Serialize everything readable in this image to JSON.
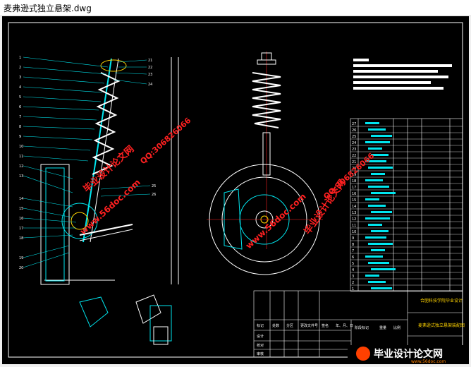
{
  "window": {
    "title": "麦弗逊式独立悬架.dwg"
  },
  "drawing": {
    "background": "#000000",
    "border_color": "#ffffff",
    "line_cyan": "#00e5ee",
    "line_white": "#ffffff",
    "line_yellow": "#ffd400",
    "left_leader_labels": [
      "1",
      "2",
      "3",
      "4",
      "5",
      "6",
      "7",
      "8",
      "9",
      "10",
      "11",
      "12",
      "13",
      "14",
      "15",
      "16",
      "17",
      "18",
      "19",
      "20"
    ],
    "right_leader_labels": [
      "21",
      "22",
      "23",
      "24",
      "25",
      "26",
      "27",
      "28",
      "29",
      "30"
    ],
    "parts_table_numbers": [
      "27",
      "26",
      "25",
      "24",
      "23",
      "22",
      "21",
      "20",
      "19",
      "18",
      "17",
      "16",
      "15",
      "14",
      "13",
      "12",
      "11",
      "10",
      "9",
      "8",
      "7",
      "6",
      "5",
      "4",
      "3",
      "2",
      "1"
    ],
    "title_block": {
      "school_name": "合肥科技学院毕业设计",
      "drawing_name": "麦弗逊式独立悬架装配图",
      "row_labels": [
        "设计",
        "校对",
        "审核",
        "工艺"
      ],
      "cells": [
        "标记",
        "处数",
        "分区",
        "更改文件号",
        "签名",
        "年、月、日"
      ],
      "stage": "阶段标记",
      "weight": "重量",
      "scale": "比例"
    }
  },
  "watermarks": {
    "brand": "毕业设计论文网",
    "url": "www.56doc.com",
    "qq": "QQ:306826066",
    "color": "#ff2020"
  }
}
